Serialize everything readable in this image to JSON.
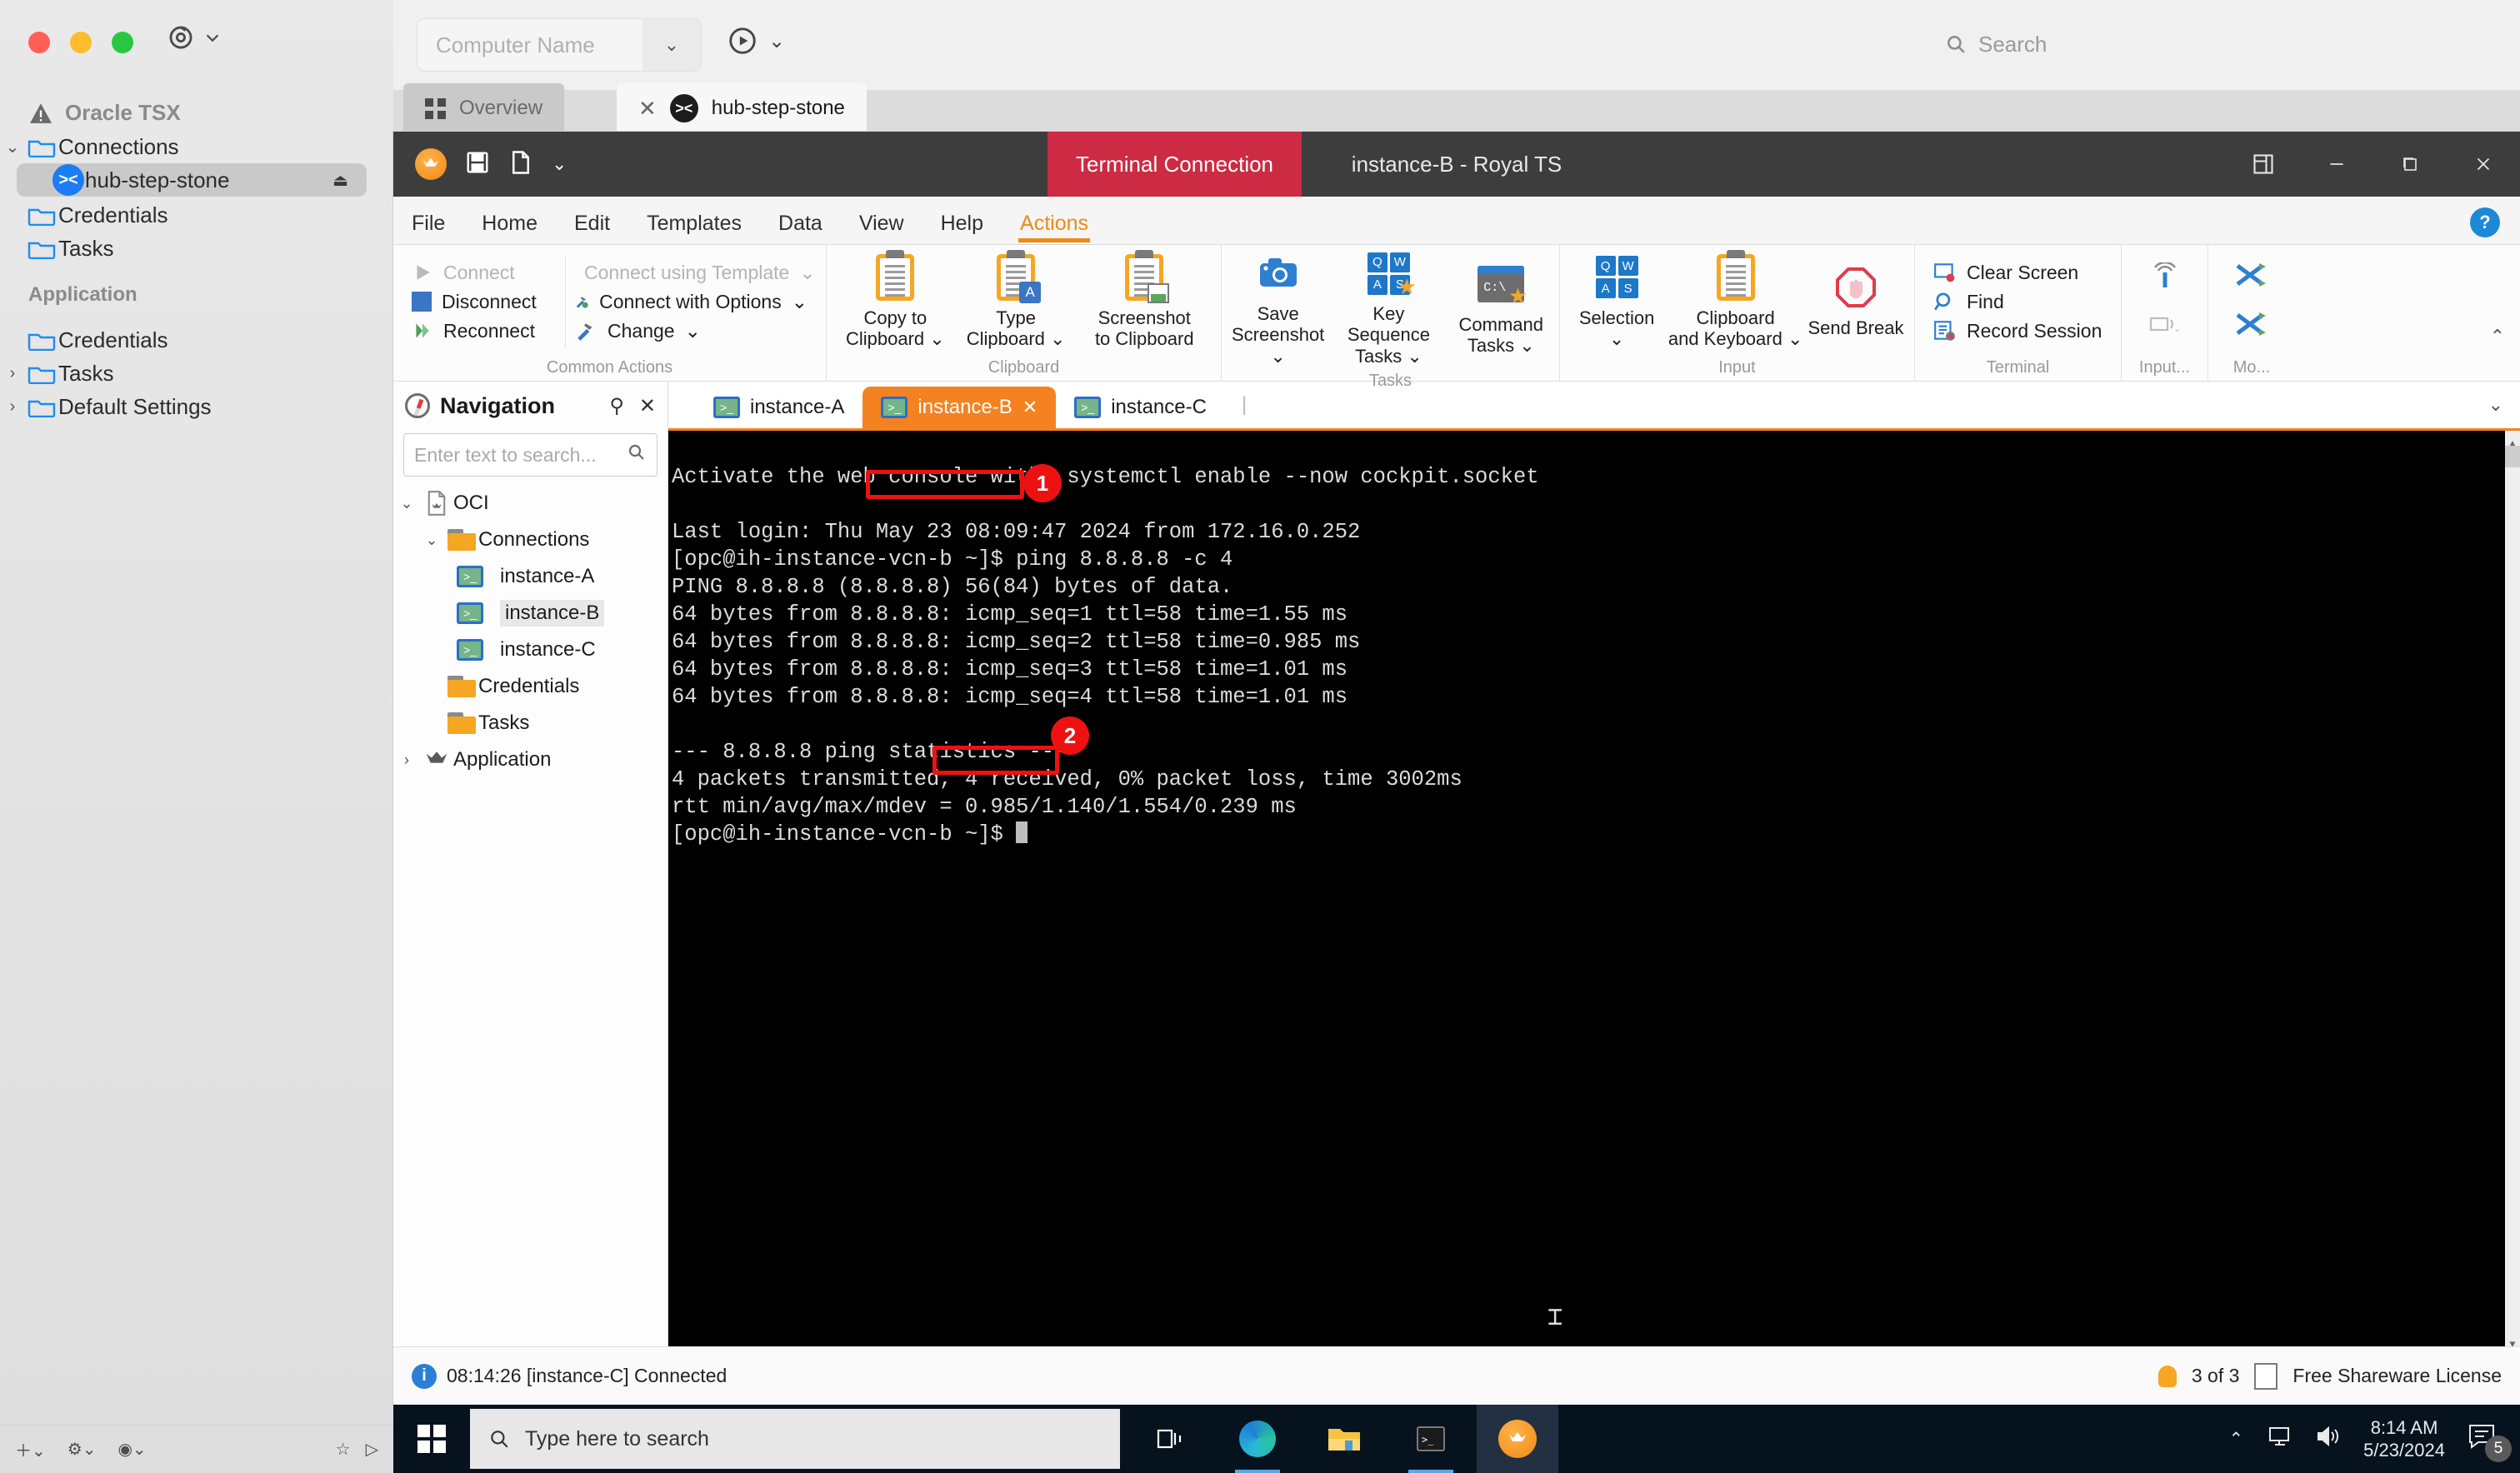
{
  "mac": {
    "sidebar": {
      "section1_title": "Oracle TSX",
      "items": [
        {
          "label": "Connections",
          "icon": "folder-icon",
          "expanded": true
        },
        {
          "label": "hub-step-stone",
          "icon": "xterm-icon",
          "selected": true
        },
        {
          "label": "Credentials",
          "icon": "folder-icon"
        },
        {
          "label": "Tasks",
          "icon": "folder-icon"
        }
      ],
      "section2_title": "Application",
      "items2": [
        {
          "label": "Credentials",
          "icon": "folder-icon"
        },
        {
          "label": "Tasks",
          "icon": "folder-icon"
        },
        {
          "label": "Default Settings",
          "icon": "folder-icon"
        }
      ]
    },
    "topbar": {
      "computer_name_placeholder": "Computer Name",
      "search_placeholder": "Search"
    },
    "tabs": [
      {
        "label": "Overview",
        "icon": "grid-icon",
        "active": false
      },
      {
        "label": "hub-step-stone",
        "icon": "xterm-icon",
        "active": true
      }
    ]
  },
  "royalts": {
    "title": "instance-B - Royal TS",
    "connection_badge": "Terminal Connection",
    "menu": [
      {
        "label": "File",
        "active": false
      },
      {
        "label": "Home",
        "active": false
      },
      {
        "label": "Edit",
        "active": false
      },
      {
        "label": "Templates",
        "active": false
      },
      {
        "label": "Data",
        "active": false
      },
      {
        "label": "View",
        "active": false
      },
      {
        "label": "Help",
        "active": false
      },
      {
        "label": "Actions",
        "active": true
      }
    ],
    "help_label": "?",
    "ribbon": {
      "common_actions": {
        "title": "Common Actions",
        "buttons": [
          {
            "label": "Connect",
            "disabled": true
          },
          {
            "label": "Disconnect",
            "disabled": false
          },
          {
            "label": "Reconnect",
            "disabled": false
          }
        ],
        "buttons2": [
          {
            "label": "Connect using Template",
            "disabled": true,
            "caret": true
          },
          {
            "label": "Connect with Options",
            "disabled": false,
            "caret": true
          },
          {
            "label": "Change",
            "disabled": false,
            "caret": true
          }
        ]
      },
      "clipboard": {
        "title": "Clipboard",
        "buttons": [
          {
            "line1": "Copy to",
            "line2": "Clipboard",
            "caret": true
          },
          {
            "line1": "Type",
            "line2": "Clipboard",
            "caret": true
          },
          {
            "line1": "Screenshot",
            "line2": "to Clipboard",
            "caret": false
          }
        ]
      },
      "tasks": {
        "title": "Tasks",
        "buttons": [
          {
            "line1": "Save",
            "line2": "Screenshot",
            "caret": true
          },
          {
            "line1": "Key Sequence",
            "line2": "Tasks",
            "caret": true
          },
          {
            "line1": "Command",
            "line2": "Tasks",
            "caret": true
          }
        ]
      },
      "input": {
        "title": "Input",
        "buttons": [
          {
            "line1": "Selection",
            "line2": "",
            "caret": true
          },
          {
            "line1": "Clipboard",
            "line2": "and Keyboard",
            "caret": true
          },
          {
            "line1": "Send Break",
            "line2": "",
            "caret": false
          }
        ]
      },
      "terminal": {
        "title": "Terminal",
        "buttons": [
          {
            "label": "Clear Screen"
          },
          {
            "label": "Find"
          },
          {
            "label": "Record Session"
          }
        ]
      },
      "input2": {
        "title": "Input..."
      },
      "mo": {
        "title": "Mo..."
      }
    },
    "navigation": {
      "title": "Navigation",
      "search_placeholder": "Enter text to search...",
      "tree": [
        {
          "label": "OCI",
          "level": 0,
          "chev": "down",
          "icon": "document-crown-icon"
        },
        {
          "label": "Connections",
          "level": 1,
          "chev": "down",
          "icon": "folder-icon"
        },
        {
          "label": "instance-A",
          "level": 2,
          "chev": "",
          "icon": "terminal-icon"
        },
        {
          "label": "instance-B",
          "level": 2,
          "chev": "",
          "icon": "terminal-icon",
          "selected": true
        },
        {
          "label": "instance-C",
          "level": 2,
          "chev": "",
          "icon": "terminal-icon"
        },
        {
          "label": "Credentials",
          "level": 1,
          "chev": "",
          "icon": "folder-icon"
        },
        {
          "label": "Tasks",
          "level": 1,
          "chev": "",
          "icon": "folder-icon"
        },
        {
          "label": "Application",
          "level": 0,
          "chev": "right",
          "icon": "crown-icon"
        }
      ]
    },
    "session_tabs": [
      {
        "label": "instance-A",
        "active": false,
        "closable": false
      },
      {
        "label": "instance-B",
        "active": true,
        "closable": true
      },
      {
        "label": "instance-C",
        "active": false,
        "closable": false
      }
    ],
    "terminal": {
      "lines": [
        "Activate the web console with: systemctl enable --now cockpit.socket",
        "",
        "Last login: Thu May 23 08:09:47 2024 from 172.16.0.252",
        "[opc@ih-instance-vcn-b ~]$ ping 8.8.8.8 -c 4",
        "PING 8.8.8.8 (8.8.8.8) 56(84) bytes of data.",
        "64 bytes from 8.8.8.8: icmp_seq=1 ttl=58 time=1.55 ms",
        "64 bytes from 8.8.8.8: icmp_seq=2 ttl=58 time=0.985 ms",
        "64 bytes from 8.8.8.8: icmp_seq=3 ttl=58 time=1.01 ms",
        "64 bytes from 8.8.8.8: icmp_seq=4 ttl=58 time=1.01 ms",
        "",
        "--- 8.8.8.8 ping statistics ---",
        "4 packets transmitted, 4 received, 0% packet loss, time 3002ms",
        "rtt min/avg/max/mdev = 0.985/1.140/1.554/0.239 ms",
        "[opc@ih-instance-vcn-b ~]$ "
      ]
    },
    "annotations": [
      {
        "number": "1",
        "target": "ping 8.8.8.8 -c 4"
      },
      {
        "number": "2",
        "target": "0% packet loss,"
      }
    ],
    "status": {
      "message": "08:14:26 [instance-C] Connected",
      "count": "3 of 3",
      "license": "Free Shareware License"
    }
  },
  "taskbar": {
    "search_placeholder": "Type here to search",
    "time": "8:14 AM",
    "date": "5/23/2024",
    "notification_count": "5"
  },
  "colors": {
    "accent_orange": "#f58220",
    "badge_red": "#cc2b43",
    "annotation_red": "#ee1111",
    "terminal_bg": "#000000"
  }
}
